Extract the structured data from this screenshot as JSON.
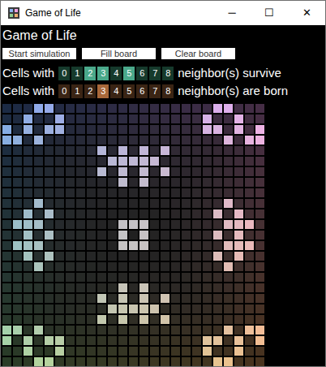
{
  "window": {
    "title": "Game of Life",
    "controls": [
      "─",
      "☐",
      "✕"
    ]
  },
  "heading": "Game of Life",
  "buttons": [
    "Start simulation",
    "Fill board",
    "Clear board"
  ],
  "rules": [
    {
      "kind": "survive",
      "prefix": "Cells with",
      "suffix": "neighbor(s) survive",
      "counts": [
        {
          "label": "0",
          "selected": false
        },
        {
          "label": "1",
          "selected": false
        },
        {
          "label": "2",
          "selected": true
        },
        {
          "label": "3",
          "selected": true
        },
        {
          "label": "4",
          "selected": false
        },
        {
          "label": "5",
          "selected": true
        },
        {
          "label": "6",
          "selected": false
        },
        {
          "label": "7",
          "selected": false
        },
        {
          "label": "8",
          "selected": false
        }
      ]
    },
    {
      "kind": "born",
      "prefix": "Cells with",
      "suffix": "neighbor(s) are born",
      "counts": [
        {
          "label": "0",
          "selected": false
        },
        {
          "label": "1",
          "selected": false
        },
        {
          "label": "2",
          "selected": false
        },
        {
          "label": "3",
          "selected": true
        },
        {
          "label": "4",
          "selected": false
        },
        {
          "label": "5",
          "selected": false
        },
        {
          "label": "6",
          "selected": false
        },
        {
          "label": "7",
          "selected": false
        },
        {
          "label": "8",
          "selected": false
        }
      ]
    }
  ],
  "board": {
    "rows": [
      "...##...............##...",
      "..#..#.............#..#..",
      "#.#.##.............##.#.#",
      "##.#.................#.##",
      ".........#.#.#.#.........",
      "..........#####..........",
      ".........#.#.#.#.........",
      "...........#.#...........",
      ".........................",
      "...#.................#...",
      "..#.#...............#.#..",
      ".###.......###.......###.",
      "..#.#......#.#......#.#..",
      ".###.......###.......###.",
      "..#.#...............#.#..",
      "...#.................#...",
      ".........................",
      "...........#.#...........",
      ".........#.#.#.#.........",
      "..........#####..........",
      ".........#.#.#.#.........",
      "##.#.................#.##",
      "#.#.##.............##.#.#",
      "..#..#.............#..#..",
      "...##...............##..."
    ]
  }
}
